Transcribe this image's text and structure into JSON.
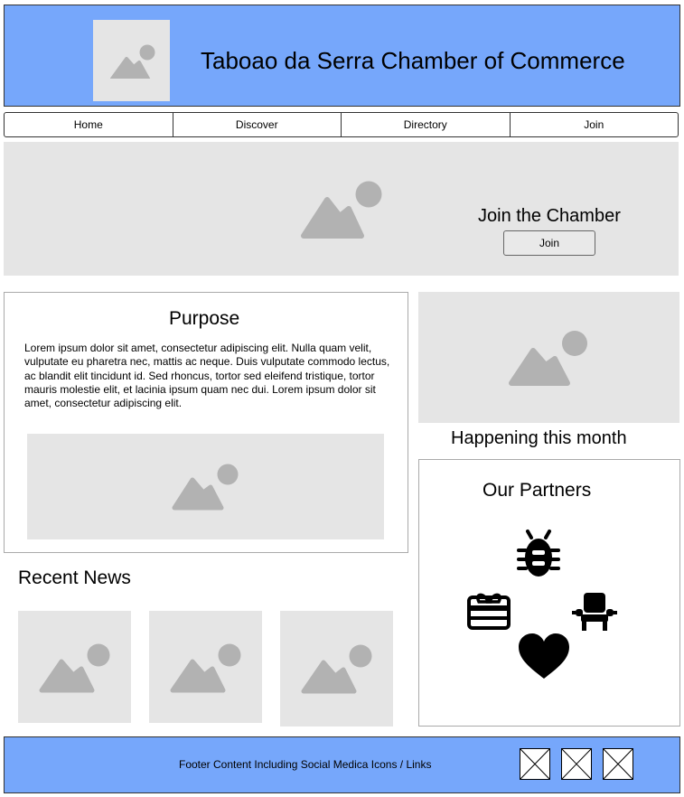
{
  "header": {
    "title": "Taboao da Serra Chamber of Commerce",
    "logo_icon": "image-placeholder-icon"
  },
  "nav": {
    "items": [
      {
        "label": "Home"
      },
      {
        "label": "Discover"
      },
      {
        "label": "Directory"
      },
      {
        "label": "Join"
      }
    ]
  },
  "hero": {
    "title": "Join the Chamber",
    "button_label": "Join"
  },
  "purpose": {
    "title": "Purpose",
    "text": "Lorem ipsum dolor sit amet, consectetur adipiscing elit. Nulla quam velit, vulputate eu pharetra nec, mattis ac neque. Duis vulputate commodo lectus, ac blandit elit tincidunt id. Sed rhoncus, tortor sed eleifend tristique, tortor mauris molestie elit, et lacinia ipsum quam nec dui. Lorem ipsum dolor sit amet, consectetur adipiscing elit."
  },
  "news": {
    "title": "Recent News"
  },
  "event": {
    "title": "Happening this month"
  },
  "partners": {
    "title": "Our Partners",
    "icons": [
      "bug-icon",
      "gift-card-icon",
      "armchair-icon",
      "heart-icon"
    ]
  },
  "footer": {
    "text": "Footer Content Including Social Medica Icons / Links",
    "social_icons": [
      "social-placeholder-icon",
      "social-placeholder-icon",
      "social-placeholder-icon"
    ]
  },
  "colors": {
    "header_bg": "#76a7fb",
    "footer_bg": "#76a7fb",
    "placeholder_bg": "#e5e5e5",
    "placeholder_icon": "#b2b2b2"
  }
}
